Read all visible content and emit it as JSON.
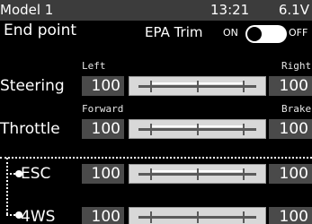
{
  "header": {
    "model_name": "Model 1",
    "time": "13:21",
    "battery": "6.1V"
  },
  "screen": {
    "title": "End point",
    "epa_label": "EPA Trim",
    "switch_on": "ON",
    "switch_off": "OFF",
    "epa_trim_on": false
  },
  "channels": [
    {
      "name": "Steering",
      "left_label": "Left",
      "right_label": "Right",
      "left_value": "100",
      "right_value": "100"
    },
    {
      "name": "Throttle",
      "left_label": "Forward",
      "right_label": "Brake",
      "left_value": "100",
      "right_value": "100"
    },
    {
      "name": "ESC",
      "left_value": "100",
      "right_value": "100"
    },
    {
      "name": "4WS",
      "left_value": "100",
      "right_value": "100"
    }
  ]
}
